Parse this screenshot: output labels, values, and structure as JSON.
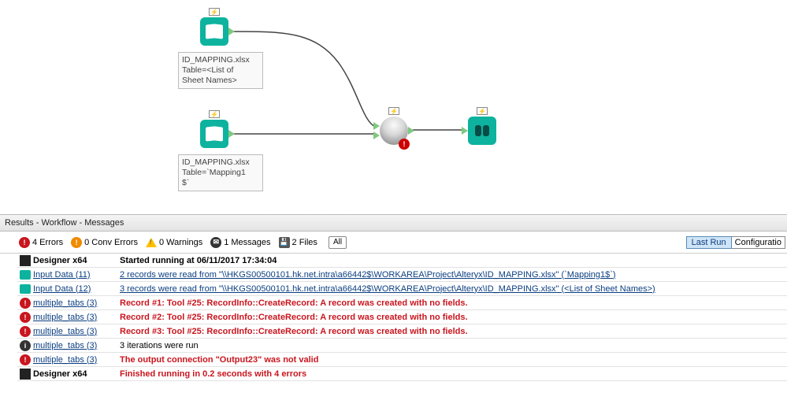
{
  "canvas": {
    "node1_label_l1": "ID_MAPPING.xlsx",
    "node1_label_l2": "Table=<List of",
    "node1_label_l3": "Sheet Names>",
    "node2_label_l1": "ID_MAPPING.xlsx",
    "node2_label_l2": "Table=`Mapping1",
    "node2_label_l3": "$`"
  },
  "results": {
    "header": "Results - Workflow - Messages",
    "status": {
      "errors": "4 Errors",
      "conv": "0 Conv Errors",
      "warn": "0 Warnings",
      "msgs": "1 Messages",
      "files": "2 Files",
      "all": "All",
      "lastrun": "Last Run",
      "config": "Configuratio"
    },
    "rows": [
      {
        "icon": "designer",
        "src": "Designer x64",
        "msg": "Started running  at 06/11/2017 17:34:04",
        "cls": "started"
      },
      {
        "icon": "input",
        "src": "Input Data (11)",
        "srcLink": true,
        "msg": "2 records were read from \"\\\\HKGS00500101.hk.net.intra\\a66442$\\WORKAREA\\Project\\Alteryx\\ID_MAPPING.xlsx\" (`Mapping1$`)",
        "msgLink": true
      },
      {
        "icon": "input",
        "src": "Input Data (12)",
        "srcLink": true,
        "msg": "3 records were read from \"\\\\HKGS00500101.hk.net.intra\\a66442$\\WORKAREA\\Project\\Alteryx\\ID_MAPPING.xlsx\" (<List of Sheet Names>)",
        "msgLink": true
      },
      {
        "icon": "err",
        "src": "multiple_tabs (3)",
        "srcLink": true,
        "msg": "Record #1: Tool #25: RecordInfo::CreateRecord:  A record was created with no fields.",
        "err": true
      },
      {
        "icon": "err",
        "src": "multiple_tabs (3)",
        "srcLink": true,
        "msg": "Record #2: Tool #25: RecordInfo::CreateRecord:  A record was created with no fields.",
        "err": true
      },
      {
        "icon": "err",
        "src": "multiple_tabs (3)",
        "srcLink": true,
        "msg": "Record #3: Tool #25: RecordInfo::CreateRecord:  A record was created with no fields.",
        "err": true
      },
      {
        "icon": "msg",
        "src": "multiple_tabs (3)",
        "srcLink": true,
        "msg": "3 iterations were run"
      },
      {
        "icon": "err",
        "src": "multiple_tabs (3)",
        "srcLink": true,
        "msg": "The output connection \"Output23\" was not valid",
        "err": true
      },
      {
        "icon": "designer",
        "src": "Designer x64",
        "msg": "Finished running  in 0.2 seconds with 4 errors",
        "err": true
      }
    ]
  }
}
